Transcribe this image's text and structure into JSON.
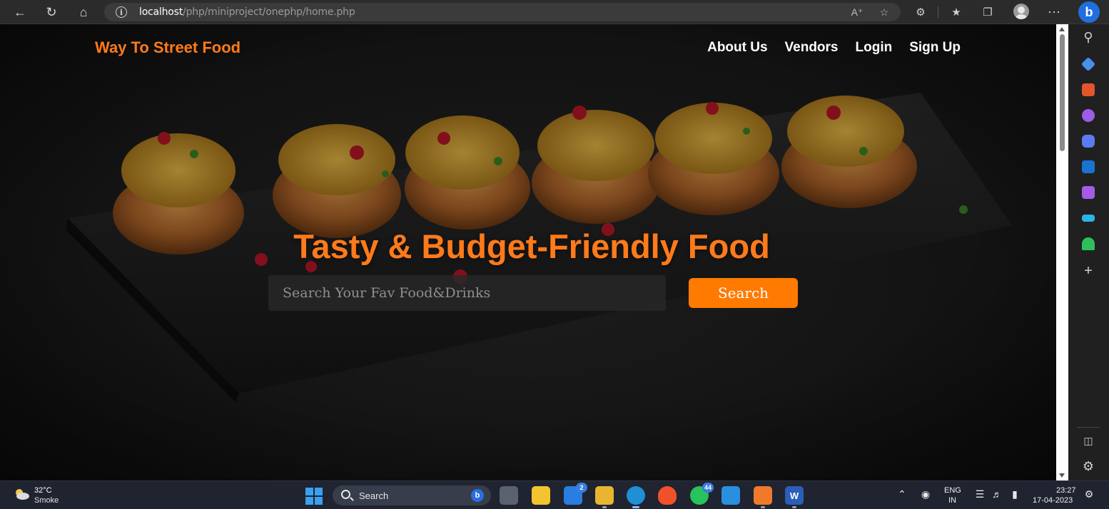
{
  "browser": {
    "url_host": "localhost",
    "url_path": "/php/miniproject/onephp/home.php"
  },
  "site": {
    "logo": "Way To Street Food",
    "nav": [
      "About Us",
      "Vendors",
      "Login",
      "Sign Up"
    ],
    "hero_title": "Tasty & Budget-Friendly Food",
    "search_placeholder": "Search Your Fav Food&Drinks",
    "search_button": "Search"
  },
  "taskbar": {
    "weather_temp": "32°C",
    "weather_desc": "Smoke",
    "search_label": "Search",
    "mail_badge": "2",
    "whatsapp_badge": "44",
    "lang_top": "ENG",
    "lang_bottom": "IN",
    "time": "23:27",
    "date": "17-04-2023"
  },
  "colors": {
    "accent_orange": "#ff7a1a",
    "button_orange": "#ff7a00",
    "browser_chrome": "#2b2b2b",
    "taskbar": "#1f2430"
  },
  "icons": {
    "browser_toolbar": [
      "back-arrow-icon",
      "refresh-icon",
      "home-icon",
      "site-info-icon",
      "read-aloud-icon",
      "add-favorite-icon",
      "extensions-icon",
      "favorites-icon",
      "collections-icon",
      "profile-icon",
      "more-menu-icon",
      "bing-copilot-icon"
    ],
    "sidebar": [
      "search-icon",
      "shopping-tag-icon",
      "tools-briefcase-icon",
      "games-icon",
      "copilot-icon",
      "outlook-icon",
      "designer-icon",
      "drop-icon",
      "tree-icon",
      "add-icon",
      "sidebar-toggle-icon",
      "settings-gear-icon"
    ]
  }
}
